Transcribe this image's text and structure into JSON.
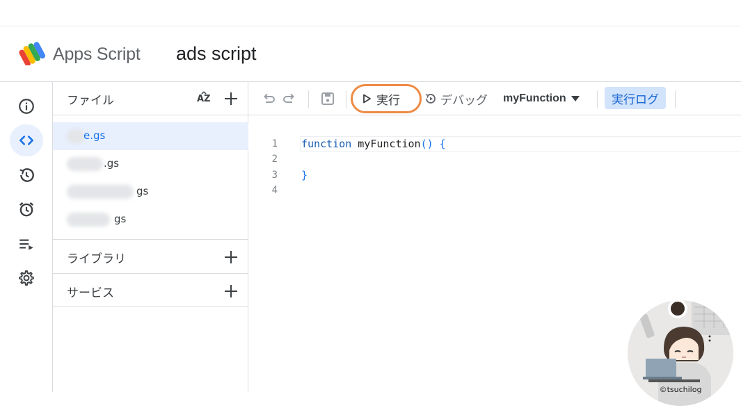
{
  "header": {
    "product_name": "Apps Script",
    "project_title": "ads script",
    "logo_icon": "apps-script-logo"
  },
  "rail": {
    "items": [
      {
        "icon": "info-icon",
        "label": "Overview"
      },
      {
        "icon": "code-icon",
        "label": "Editor",
        "active": true
      },
      {
        "icon": "history-icon",
        "label": "Executions"
      },
      {
        "icon": "alarm-icon",
        "label": "Triggers"
      },
      {
        "icon": "queue-icon",
        "label": "Executions queue"
      },
      {
        "icon": "gear-icon",
        "label": "Settings"
      }
    ]
  },
  "files_panel": {
    "title": "ファイル",
    "sort_label": "AZ",
    "files": [
      {
        "name": "e.gs",
        "selected": true
      },
      {
        "name": ".gs",
        "selected": false
      },
      {
        "name": "gs",
        "selected": false
      },
      {
        "name": "gs",
        "selected": false
      }
    ],
    "sections": [
      {
        "title": "ライブラリ"
      },
      {
        "title": "サービス"
      }
    ]
  },
  "toolbar": {
    "run_label": "実行",
    "debug_label": "デバッグ",
    "function_name": "myFunction",
    "log_label": "実行ログ",
    "highlight_color": "#ee8a44"
  },
  "editor": {
    "line_numbers": [
      "1",
      "2",
      "3",
      "4"
    ],
    "lines": [
      {
        "keyword": "function",
        "rest": " myFunction",
        "parens": "() {"
      },
      {
        "text": ""
      },
      {
        "text": "}"
      },
      {
        "text": ""
      }
    ]
  },
  "watermark": {
    "text": "©tsuchilog"
  },
  "colors": {
    "accent": "#1a73e8",
    "active_bg": "#e8f0fe",
    "log_bg": "#d2e3fc",
    "border": "#dadce0"
  }
}
